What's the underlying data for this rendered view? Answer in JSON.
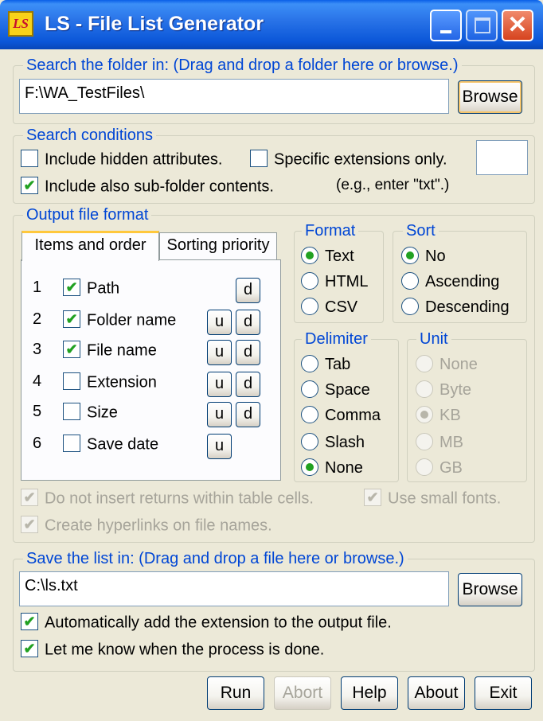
{
  "window": {
    "title": "LS - File List Generator",
    "icon_text": "LS",
    "icon": "ls-app-icon"
  },
  "search_folder": {
    "legend": "Search the folder in: (Drag and drop a folder here or browse.)",
    "path": "F:\\WA_TestFiles\\",
    "browse_label": "Browse"
  },
  "conditions": {
    "legend": "Search conditions",
    "include_hidden": {
      "label": "Include hidden attributes.",
      "checked": false
    },
    "specific_ext": {
      "label": "Specific extensions only.",
      "checked": false
    },
    "include_subfolders": {
      "label": "Include also sub-folder contents.",
      "checked": true
    },
    "ext_hint": "(e.g., enter \"txt\".)",
    "ext_value": ""
  },
  "output": {
    "legend": "Output file format",
    "tabs": [
      "Items and order",
      "Sorting priority"
    ],
    "items": [
      {
        "num": "1",
        "label": "Path",
        "checked": true
      },
      {
        "num": "2",
        "label": "Folder name",
        "checked": true
      },
      {
        "num": "3",
        "label": "File name",
        "checked": true
      },
      {
        "num": "4",
        "label": "Extension",
        "checked": false
      },
      {
        "num": "5",
        "label": "Size",
        "checked": false
      },
      {
        "num": "6",
        "label": "Save date",
        "checked": false
      }
    ],
    "up_label": "u",
    "down_label": "d",
    "format": {
      "legend": "Format",
      "options": [
        "Text",
        "HTML",
        "CSV"
      ],
      "selected": "Text"
    },
    "sort": {
      "legend": "Sort",
      "options": [
        "No",
        "Ascending",
        "Descending"
      ],
      "selected": "No"
    },
    "delimiter": {
      "legend": "Delimiter",
      "options": [
        "Tab",
        "Space",
        "Comma",
        "Slash",
        "None"
      ],
      "selected": "None"
    },
    "unit": {
      "legend": "Unit",
      "options": [
        "None",
        "Byte",
        "KB",
        "MB",
        "GB"
      ],
      "selected": "KB",
      "enabled": false
    },
    "no_returns": {
      "label": "Do not insert returns within table cells.",
      "checked": true,
      "enabled": false
    },
    "small_fonts": {
      "label": "Use small fonts.",
      "checked": true,
      "enabled": false
    },
    "hyperlinks": {
      "label": "Create hyperlinks on file names.",
      "checked": true,
      "enabled": false
    }
  },
  "save": {
    "legend": "Save the list in: (Drag and drop a file here or browse.)",
    "path": "C:\\ls.txt",
    "browse_label": "Browse",
    "auto_ext": {
      "label": "Automatically add the extension to the output file.",
      "checked": true
    },
    "notify": {
      "label": "Let me know when the process is done.",
      "checked": true
    }
  },
  "actions": {
    "run": "Run",
    "abort": "Abort",
    "help": "Help",
    "about": "About",
    "exit": "Exit"
  },
  "colors": {
    "accent": "#0046d5",
    "check": "#21a121",
    "titlebar": "#0a56d8",
    "face": "#ece9d8"
  }
}
